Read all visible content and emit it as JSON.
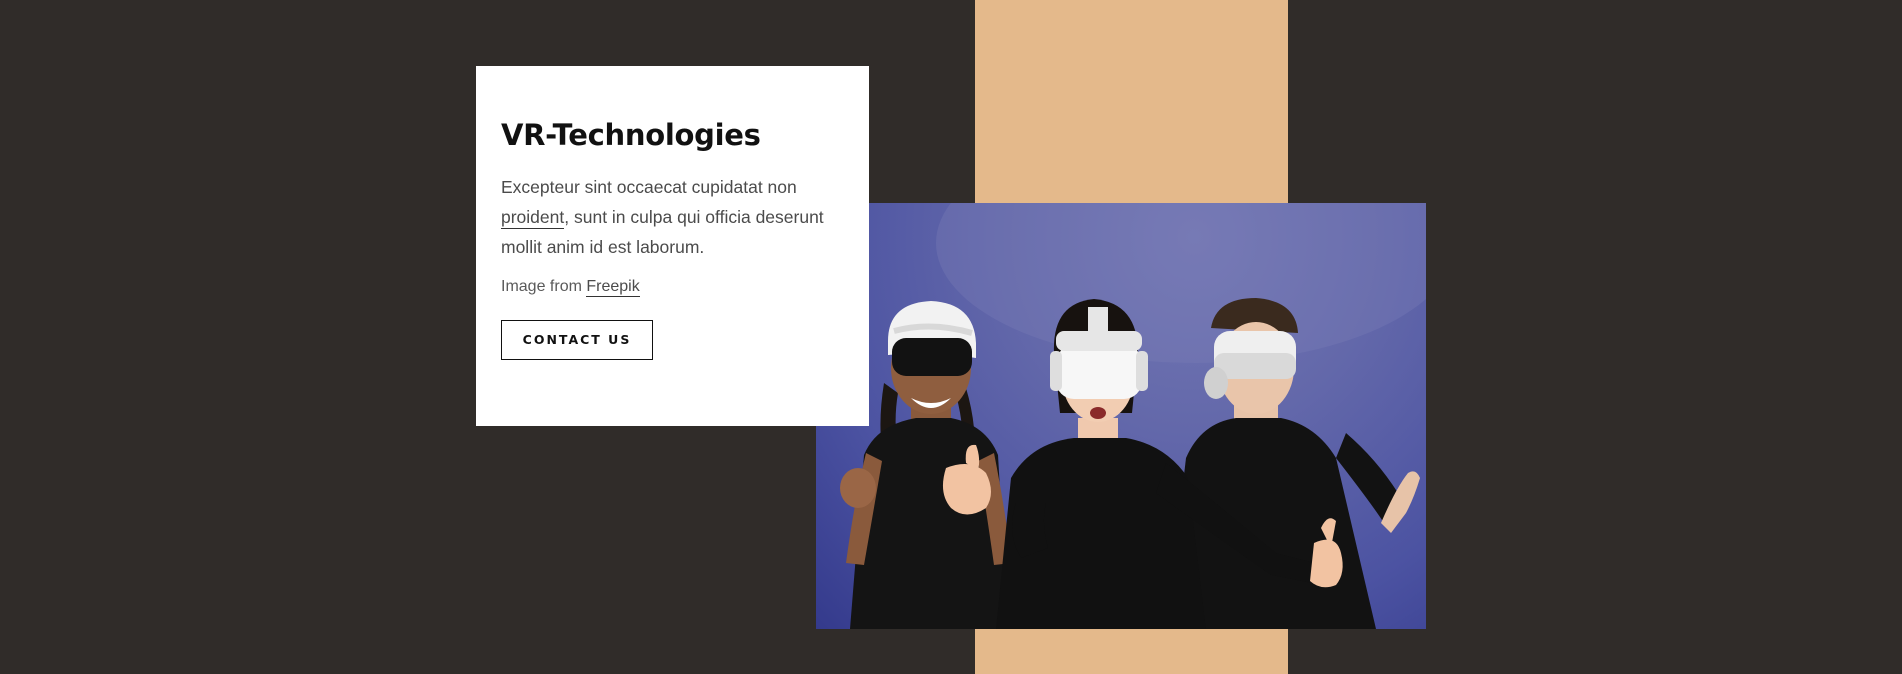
{
  "card": {
    "title": "VR-Technologies",
    "body_before_link": "Excepteur sint occaecat cupidatat non ",
    "body_link": "proident",
    "body_after_link": ", sunt in culpa qui officia deserunt mollit anim id est laborum.",
    "credit_prefix": "Image from ",
    "credit_link": "Freepik",
    "button_label": "CONTACT US"
  },
  "image": {
    "alt": "Three people wearing VR headsets"
  },
  "colors": {
    "page_background": "#302c29",
    "accent_stripe": "#e4b98b",
    "card_background": "#ffffff",
    "photo_background": "#5a60aa"
  }
}
